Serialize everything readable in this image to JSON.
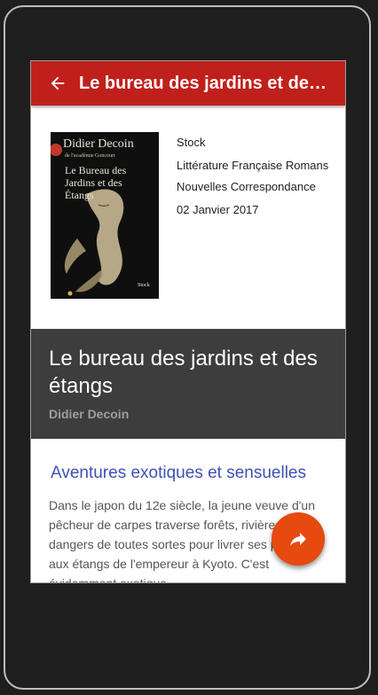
{
  "appbar": {
    "title": "Le bureau des jardins et des ...",
    "back_icon": "arrow-back-icon",
    "color": "#c0201b"
  },
  "book": {
    "cover": {
      "author": "Didier Decoin",
      "subtitle": "de l'académie Goncourt",
      "title": "Le Bureau des Jardins et des Étangs",
      "publisher": "Stock"
    },
    "publisher": "Stock",
    "genres": [
      "Littérature Française Romans",
      "Nouvelles Correspondance"
    ],
    "date": "02 Janvier 2017"
  },
  "header": {
    "title": "Le bureau des jardins et des étangs",
    "author": "Didier Decoin"
  },
  "content": {
    "teaser": "Aventures exotiques et sensuelles",
    "description": "Dans le japon du 12e siècle, la jeune veuve d'un pêcheur de carpes traverse forêts, rivières et dangers de toutes sortes pour livrer ses poissons aux étangs de l'empereur à Kyoto. C'est évidemment exotique..."
  },
  "fab": {
    "icon": "share-icon",
    "color": "#e64a0e"
  }
}
